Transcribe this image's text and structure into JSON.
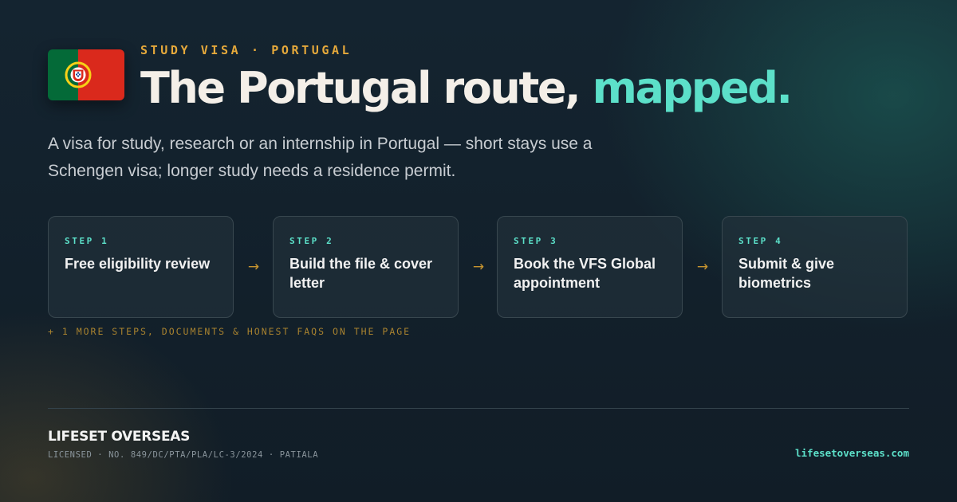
{
  "header": {
    "eyebrow": "STUDY VISA · PORTUGAL",
    "headline_main": "The Portugal route,",
    "headline_accent": "mapped.",
    "flag_icon": "portugal-flag-icon"
  },
  "lead": "A visa for study, research or an internship in Portugal — short stays use a Schengen visa; longer study needs a residence permit.",
  "steps": [
    {
      "label": "STEP 1",
      "title": "Free eligibility review"
    },
    {
      "label": "STEP 2",
      "title": "Build the file & cover letter"
    },
    {
      "label": "STEP 3",
      "title": "Book the VFS Global appointment"
    },
    {
      "label": "STEP 4",
      "title": "Submit & give biometrics"
    }
  ],
  "arrow_glyph": "→",
  "more_text": "+ 1 MORE STEPS, DOCUMENTS & HONEST FAQS ON THE PAGE",
  "footer": {
    "brand": "LIFESET OVERSEAS",
    "license": "LICENSED · NO. 849/DC/PTA/PLA/LC-3/2024 · PATIALA",
    "site": "lifesetoverseas.com"
  },
  "colors": {
    "accent_teal": "#5ce0c9",
    "accent_amber": "#e6a93b",
    "background": "#12202b",
    "flag_green": "#046a38",
    "flag_red": "#da291c"
  }
}
